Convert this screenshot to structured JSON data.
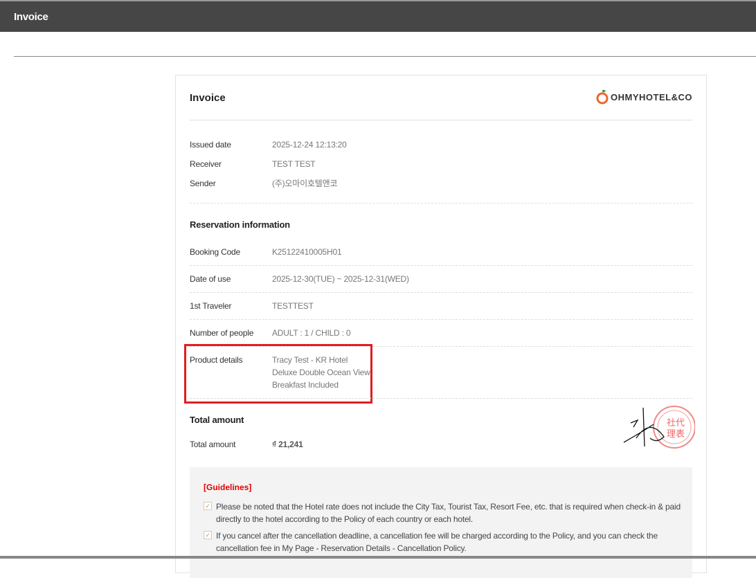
{
  "window": {
    "title": "Invoice"
  },
  "invoice": {
    "title": "Invoice",
    "logo_text": "OHMYHOTEL&CO",
    "issued_date": {
      "label": "Issued date",
      "value": "2025-12-24 12:13:20"
    },
    "receiver": {
      "label": "Receiver",
      "value": "TEST TEST"
    },
    "sender": {
      "label": "Sender",
      "value": "(주)오마이호텔앤코"
    }
  },
  "reservation": {
    "heading": "Reservation information",
    "booking_code": {
      "label": "Booking Code",
      "value": "K25122410005H01"
    },
    "date_of_use": {
      "label": "Date of use",
      "value": "2025-12-30(TUE) ~ 2025-12-31(WED)"
    },
    "traveler": {
      "label": "1st Traveler",
      "value": "TESTTEST"
    },
    "people": {
      "label": "Number of people",
      "value": "ADULT : 1 / CHILD : 0"
    },
    "product": {
      "label": "Product details",
      "lines": [
        "Tracy Test - KR Hotel",
        "Deluxe Double Ocean View",
        "Breakfast Included"
      ]
    }
  },
  "total": {
    "heading": "Total amount",
    "label": "Total amount",
    "value": "₫ 21,241"
  },
  "guidelines": {
    "title": "[Guidelines]",
    "items": [
      "Please be noted that the Hotel rate does not include the City Tax, Tourist Tax, Resort Fee, etc. that is required when check-in & paid directly to the hotel according to the Policy of each country or each hotel.",
      "If you cancel after the cancellation deadline, a cancellation fee will be charged according to the Policy, and you can check the cancellation fee in My Page - Reservation Details - Cancellation Policy."
    ]
  },
  "colors": {
    "header": "#464646",
    "highlight": "#e21d1d",
    "guideline_title": "#e60000",
    "check": "#f08a2c"
  }
}
